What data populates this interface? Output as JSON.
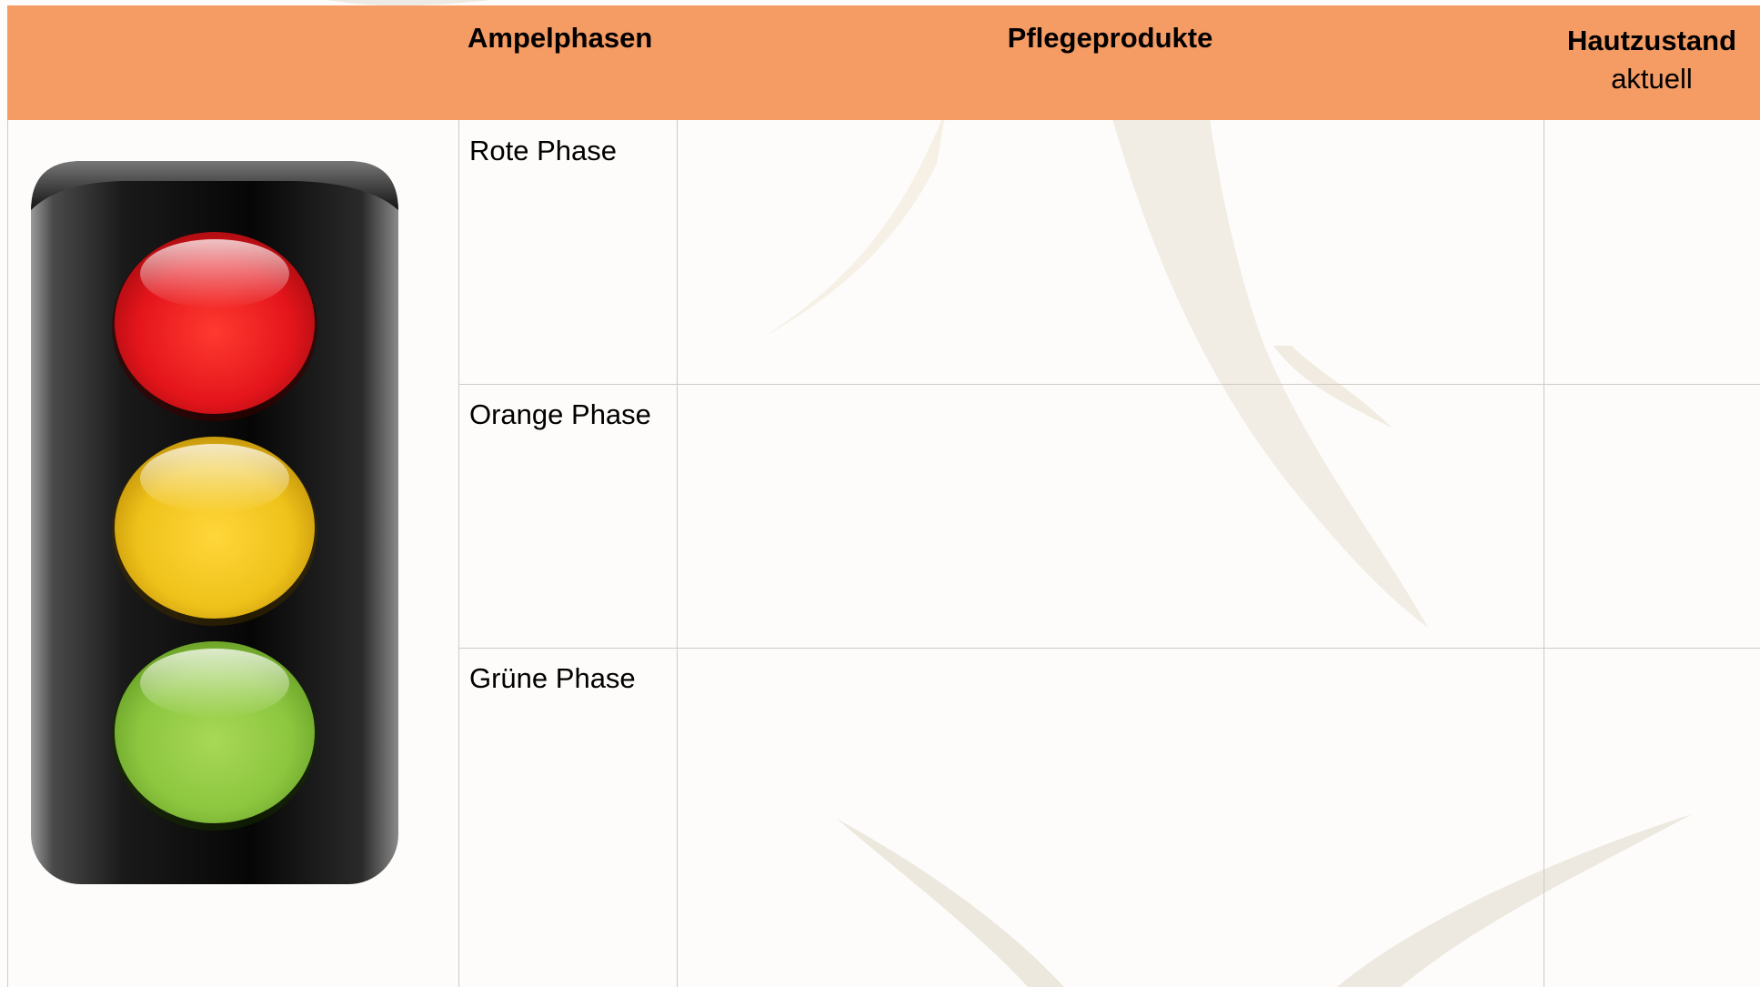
{
  "header": {
    "col_ampelphasen": "Ampelphasen",
    "col_pflegeprodukte": "Pflegeprodukte",
    "col_hautzustand": "Hautzustand",
    "col_hautzustand_sub": "aktuell"
  },
  "rows": [
    {
      "label": "Rote Phase"
    },
    {
      "label": "Orange Phase"
    },
    {
      "label": "Grüne Phase"
    }
  ],
  "traffic_light": {
    "lights": [
      "red",
      "yellow",
      "green"
    ]
  },
  "colors": {
    "header_bg": "#f59b64",
    "grid_line": "#cfcac4",
    "light_red": "#e4151b",
    "light_yellow": "#efc21a",
    "light_green": "#8cc63f"
  }
}
